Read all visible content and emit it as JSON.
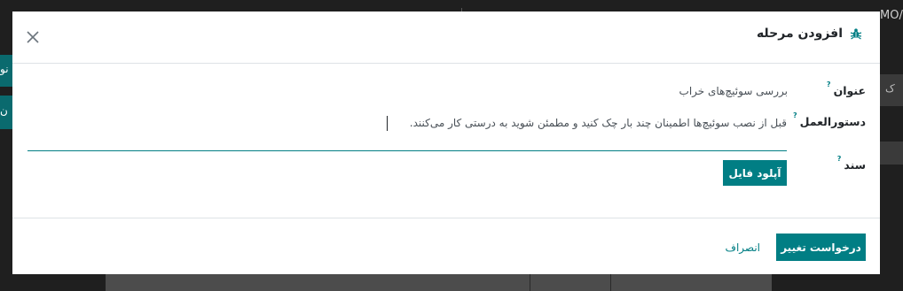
{
  "background": {
    "corner_text": "MO/",
    "left_tab_1": "نو",
    "left_tab_2": "ن",
    "right_ctrl_1": "ک"
  },
  "dialog": {
    "title": "افزودن مرحله",
    "close_icon": "close-icon",
    "title_icon": "bug-icon"
  },
  "form": {
    "title_label": "عنوان",
    "title_value": "بررسی سوئیچ‌های خراب",
    "instruction_label": "دستورالعمل",
    "instruction_value": "قبل از نصب سوئیچ‌ها اطمینان چند بار چک کنید و مطمئن شوید به درستی کار می‌کنند.",
    "document_label": "سند",
    "upload_label": "آپلود فایل",
    "help_mark": "?"
  },
  "footer": {
    "primary_label": "درخواست تغییر",
    "cancel_label": "انصراف"
  },
  "colors": {
    "accent": "#017e84",
    "overlay": "#1f1f1f"
  }
}
